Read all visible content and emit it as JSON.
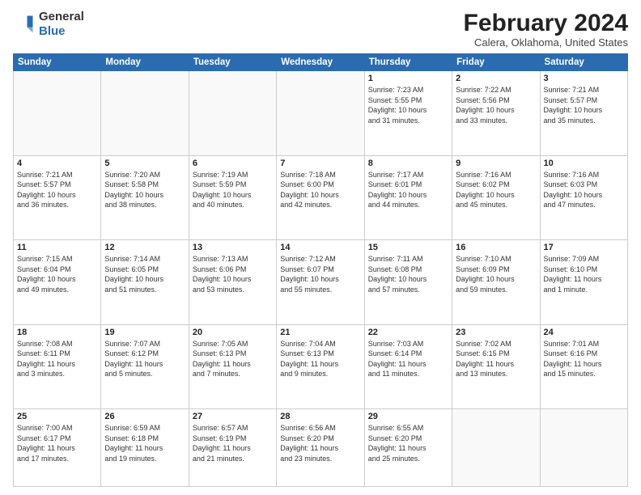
{
  "header": {
    "logo_general": "General",
    "logo_blue": "Blue",
    "title": "February 2024",
    "subtitle": "Calera, Oklahoma, United States"
  },
  "columns": [
    "Sunday",
    "Monday",
    "Tuesday",
    "Wednesday",
    "Thursday",
    "Friday",
    "Saturday"
  ],
  "weeks": [
    [
      {
        "day": "",
        "info": ""
      },
      {
        "day": "",
        "info": ""
      },
      {
        "day": "",
        "info": ""
      },
      {
        "day": "",
        "info": ""
      },
      {
        "day": "1",
        "info": "Sunrise: 7:23 AM\nSunset: 5:55 PM\nDaylight: 10 hours\nand 31 minutes."
      },
      {
        "day": "2",
        "info": "Sunrise: 7:22 AM\nSunset: 5:56 PM\nDaylight: 10 hours\nand 33 minutes."
      },
      {
        "day": "3",
        "info": "Sunrise: 7:21 AM\nSunset: 5:57 PM\nDaylight: 10 hours\nand 35 minutes."
      }
    ],
    [
      {
        "day": "4",
        "info": "Sunrise: 7:21 AM\nSunset: 5:57 PM\nDaylight: 10 hours\nand 36 minutes."
      },
      {
        "day": "5",
        "info": "Sunrise: 7:20 AM\nSunset: 5:58 PM\nDaylight: 10 hours\nand 38 minutes."
      },
      {
        "day": "6",
        "info": "Sunrise: 7:19 AM\nSunset: 5:59 PM\nDaylight: 10 hours\nand 40 minutes."
      },
      {
        "day": "7",
        "info": "Sunrise: 7:18 AM\nSunset: 6:00 PM\nDaylight: 10 hours\nand 42 minutes."
      },
      {
        "day": "8",
        "info": "Sunrise: 7:17 AM\nSunset: 6:01 PM\nDaylight: 10 hours\nand 44 minutes."
      },
      {
        "day": "9",
        "info": "Sunrise: 7:16 AM\nSunset: 6:02 PM\nDaylight: 10 hours\nand 45 minutes."
      },
      {
        "day": "10",
        "info": "Sunrise: 7:16 AM\nSunset: 6:03 PM\nDaylight: 10 hours\nand 47 minutes."
      }
    ],
    [
      {
        "day": "11",
        "info": "Sunrise: 7:15 AM\nSunset: 6:04 PM\nDaylight: 10 hours\nand 49 minutes."
      },
      {
        "day": "12",
        "info": "Sunrise: 7:14 AM\nSunset: 6:05 PM\nDaylight: 10 hours\nand 51 minutes."
      },
      {
        "day": "13",
        "info": "Sunrise: 7:13 AM\nSunset: 6:06 PM\nDaylight: 10 hours\nand 53 minutes."
      },
      {
        "day": "14",
        "info": "Sunrise: 7:12 AM\nSunset: 6:07 PM\nDaylight: 10 hours\nand 55 minutes."
      },
      {
        "day": "15",
        "info": "Sunrise: 7:11 AM\nSunset: 6:08 PM\nDaylight: 10 hours\nand 57 minutes."
      },
      {
        "day": "16",
        "info": "Sunrise: 7:10 AM\nSunset: 6:09 PM\nDaylight: 10 hours\nand 59 minutes."
      },
      {
        "day": "17",
        "info": "Sunrise: 7:09 AM\nSunset: 6:10 PM\nDaylight: 11 hours\nand 1 minute."
      }
    ],
    [
      {
        "day": "18",
        "info": "Sunrise: 7:08 AM\nSunset: 6:11 PM\nDaylight: 11 hours\nand 3 minutes."
      },
      {
        "day": "19",
        "info": "Sunrise: 7:07 AM\nSunset: 6:12 PM\nDaylight: 11 hours\nand 5 minutes."
      },
      {
        "day": "20",
        "info": "Sunrise: 7:05 AM\nSunset: 6:13 PM\nDaylight: 11 hours\nand 7 minutes."
      },
      {
        "day": "21",
        "info": "Sunrise: 7:04 AM\nSunset: 6:13 PM\nDaylight: 11 hours\nand 9 minutes."
      },
      {
        "day": "22",
        "info": "Sunrise: 7:03 AM\nSunset: 6:14 PM\nDaylight: 11 hours\nand 11 minutes."
      },
      {
        "day": "23",
        "info": "Sunrise: 7:02 AM\nSunset: 6:15 PM\nDaylight: 11 hours\nand 13 minutes."
      },
      {
        "day": "24",
        "info": "Sunrise: 7:01 AM\nSunset: 6:16 PM\nDaylight: 11 hours\nand 15 minutes."
      }
    ],
    [
      {
        "day": "25",
        "info": "Sunrise: 7:00 AM\nSunset: 6:17 PM\nDaylight: 11 hours\nand 17 minutes."
      },
      {
        "day": "26",
        "info": "Sunrise: 6:59 AM\nSunset: 6:18 PM\nDaylight: 11 hours\nand 19 minutes."
      },
      {
        "day": "27",
        "info": "Sunrise: 6:57 AM\nSunset: 6:19 PM\nDaylight: 11 hours\nand 21 minutes."
      },
      {
        "day": "28",
        "info": "Sunrise: 6:56 AM\nSunset: 6:20 PM\nDaylight: 11 hours\nand 23 minutes."
      },
      {
        "day": "29",
        "info": "Sunrise: 6:55 AM\nSunset: 6:20 PM\nDaylight: 11 hours\nand 25 minutes."
      },
      {
        "day": "",
        "info": ""
      },
      {
        "day": "",
        "info": ""
      }
    ]
  ]
}
